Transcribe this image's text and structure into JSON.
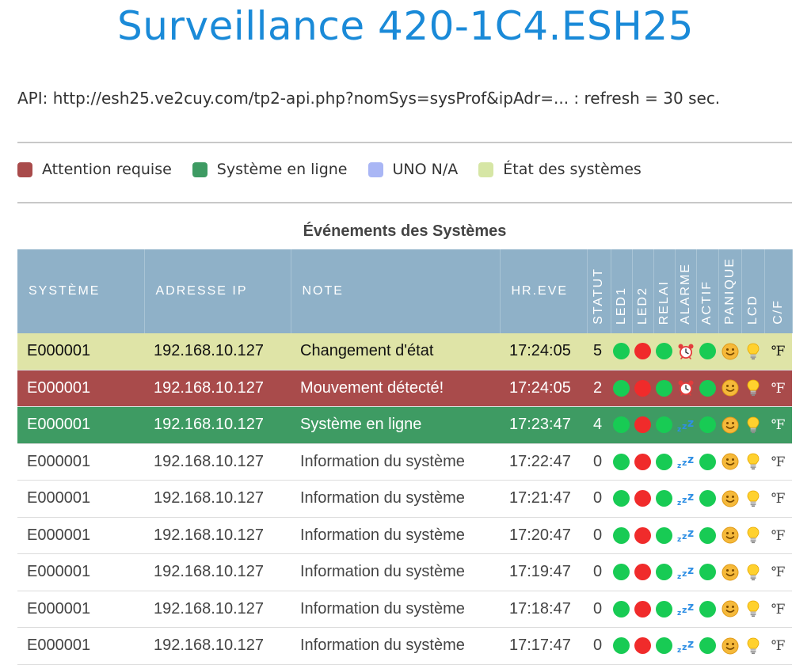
{
  "page": {
    "title": "Surveillance 420-1C4.ESH25",
    "api_line": "API: http://esh25.ve2cuy.com/tp2-api.php?nomSys=sysProf&ipAdr=... : refresh = 30 sec."
  },
  "legend": [
    {
      "label": "Attention requise",
      "color": "#a94b4b"
    },
    {
      "label": "Système en ligne",
      "color": "#3e9b63"
    },
    {
      "label": "UNO N/A",
      "color": "#a9b6f5"
    },
    {
      "label": "État des systèmes",
      "color": "#d6e6a5"
    }
  ],
  "table": {
    "title": "Événements des Systèmes",
    "headers": {
      "system": "SYSTÈME",
      "ip": "ADRESSE IP",
      "note": "NOTE",
      "time": "HR.EVE",
      "status": "STATUT",
      "led1": "LED1",
      "led2": "LED2",
      "relay": "RELAI",
      "alarm": "ALARME",
      "active": "ACTIF",
      "panic": "PANIQUE",
      "lcd": "LCD",
      "cf": "C/F"
    },
    "rows": [
      {
        "system": "E000001",
        "ip": "192.168.10.127",
        "note": "Changement d'état",
        "time": "17:24:05",
        "status": "5",
        "style": "yellow",
        "alarm_icon": "alarm-clock-icon",
        "cf": "℉"
      },
      {
        "system": "E000001",
        "ip": "192.168.10.127",
        "note": "Mouvement détecté!",
        "time": "17:24:05",
        "status": "2",
        "style": "red",
        "alarm_icon": "alarm-clock-icon",
        "cf": "℉"
      },
      {
        "system": "E000001",
        "ip": "192.168.10.127",
        "note": "Système en ligne",
        "time": "17:23:47",
        "status": "4",
        "style": "green",
        "alarm_icon": "sleep-icon",
        "cf": "℉"
      },
      {
        "system": "E000001",
        "ip": "192.168.10.127",
        "note": "Information du système",
        "time": "17:22:47",
        "status": "0",
        "style": "white",
        "alarm_icon": "sleep-icon",
        "cf": "℉"
      },
      {
        "system": "E000001",
        "ip": "192.168.10.127",
        "note": "Information du système",
        "time": "17:21:47",
        "status": "0",
        "style": "white",
        "alarm_icon": "sleep-icon",
        "cf": "℉"
      },
      {
        "system": "E000001",
        "ip": "192.168.10.127",
        "note": "Information du système",
        "time": "17:20:47",
        "status": "0",
        "style": "white",
        "alarm_icon": "sleep-icon",
        "cf": "℉"
      },
      {
        "system": "E000001",
        "ip": "192.168.10.127",
        "note": "Information du système",
        "time": "17:19:47",
        "status": "0",
        "style": "white",
        "alarm_icon": "sleep-icon",
        "cf": "℉"
      },
      {
        "system": "E000001",
        "ip": "192.168.10.127",
        "note": "Information du système",
        "time": "17:18:47",
        "status": "0",
        "style": "white",
        "alarm_icon": "sleep-icon",
        "cf": "℉"
      },
      {
        "system": "E000001",
        "ip": "192.168.10.127",
        "note": "Information du système",
        "time": "17:17:47",
        "status": "0",
        "style": "white",
        "alarm_icon": "sleep-icon",
        "cf": "℉"
      }
    ]
  },
  "colors": {
    "title": "#1a8ad8",
    "header_bg": "#8fb1c8",
    "led_on": "#18cb54",
    "led_off": "#f02b2b"
  }
}
